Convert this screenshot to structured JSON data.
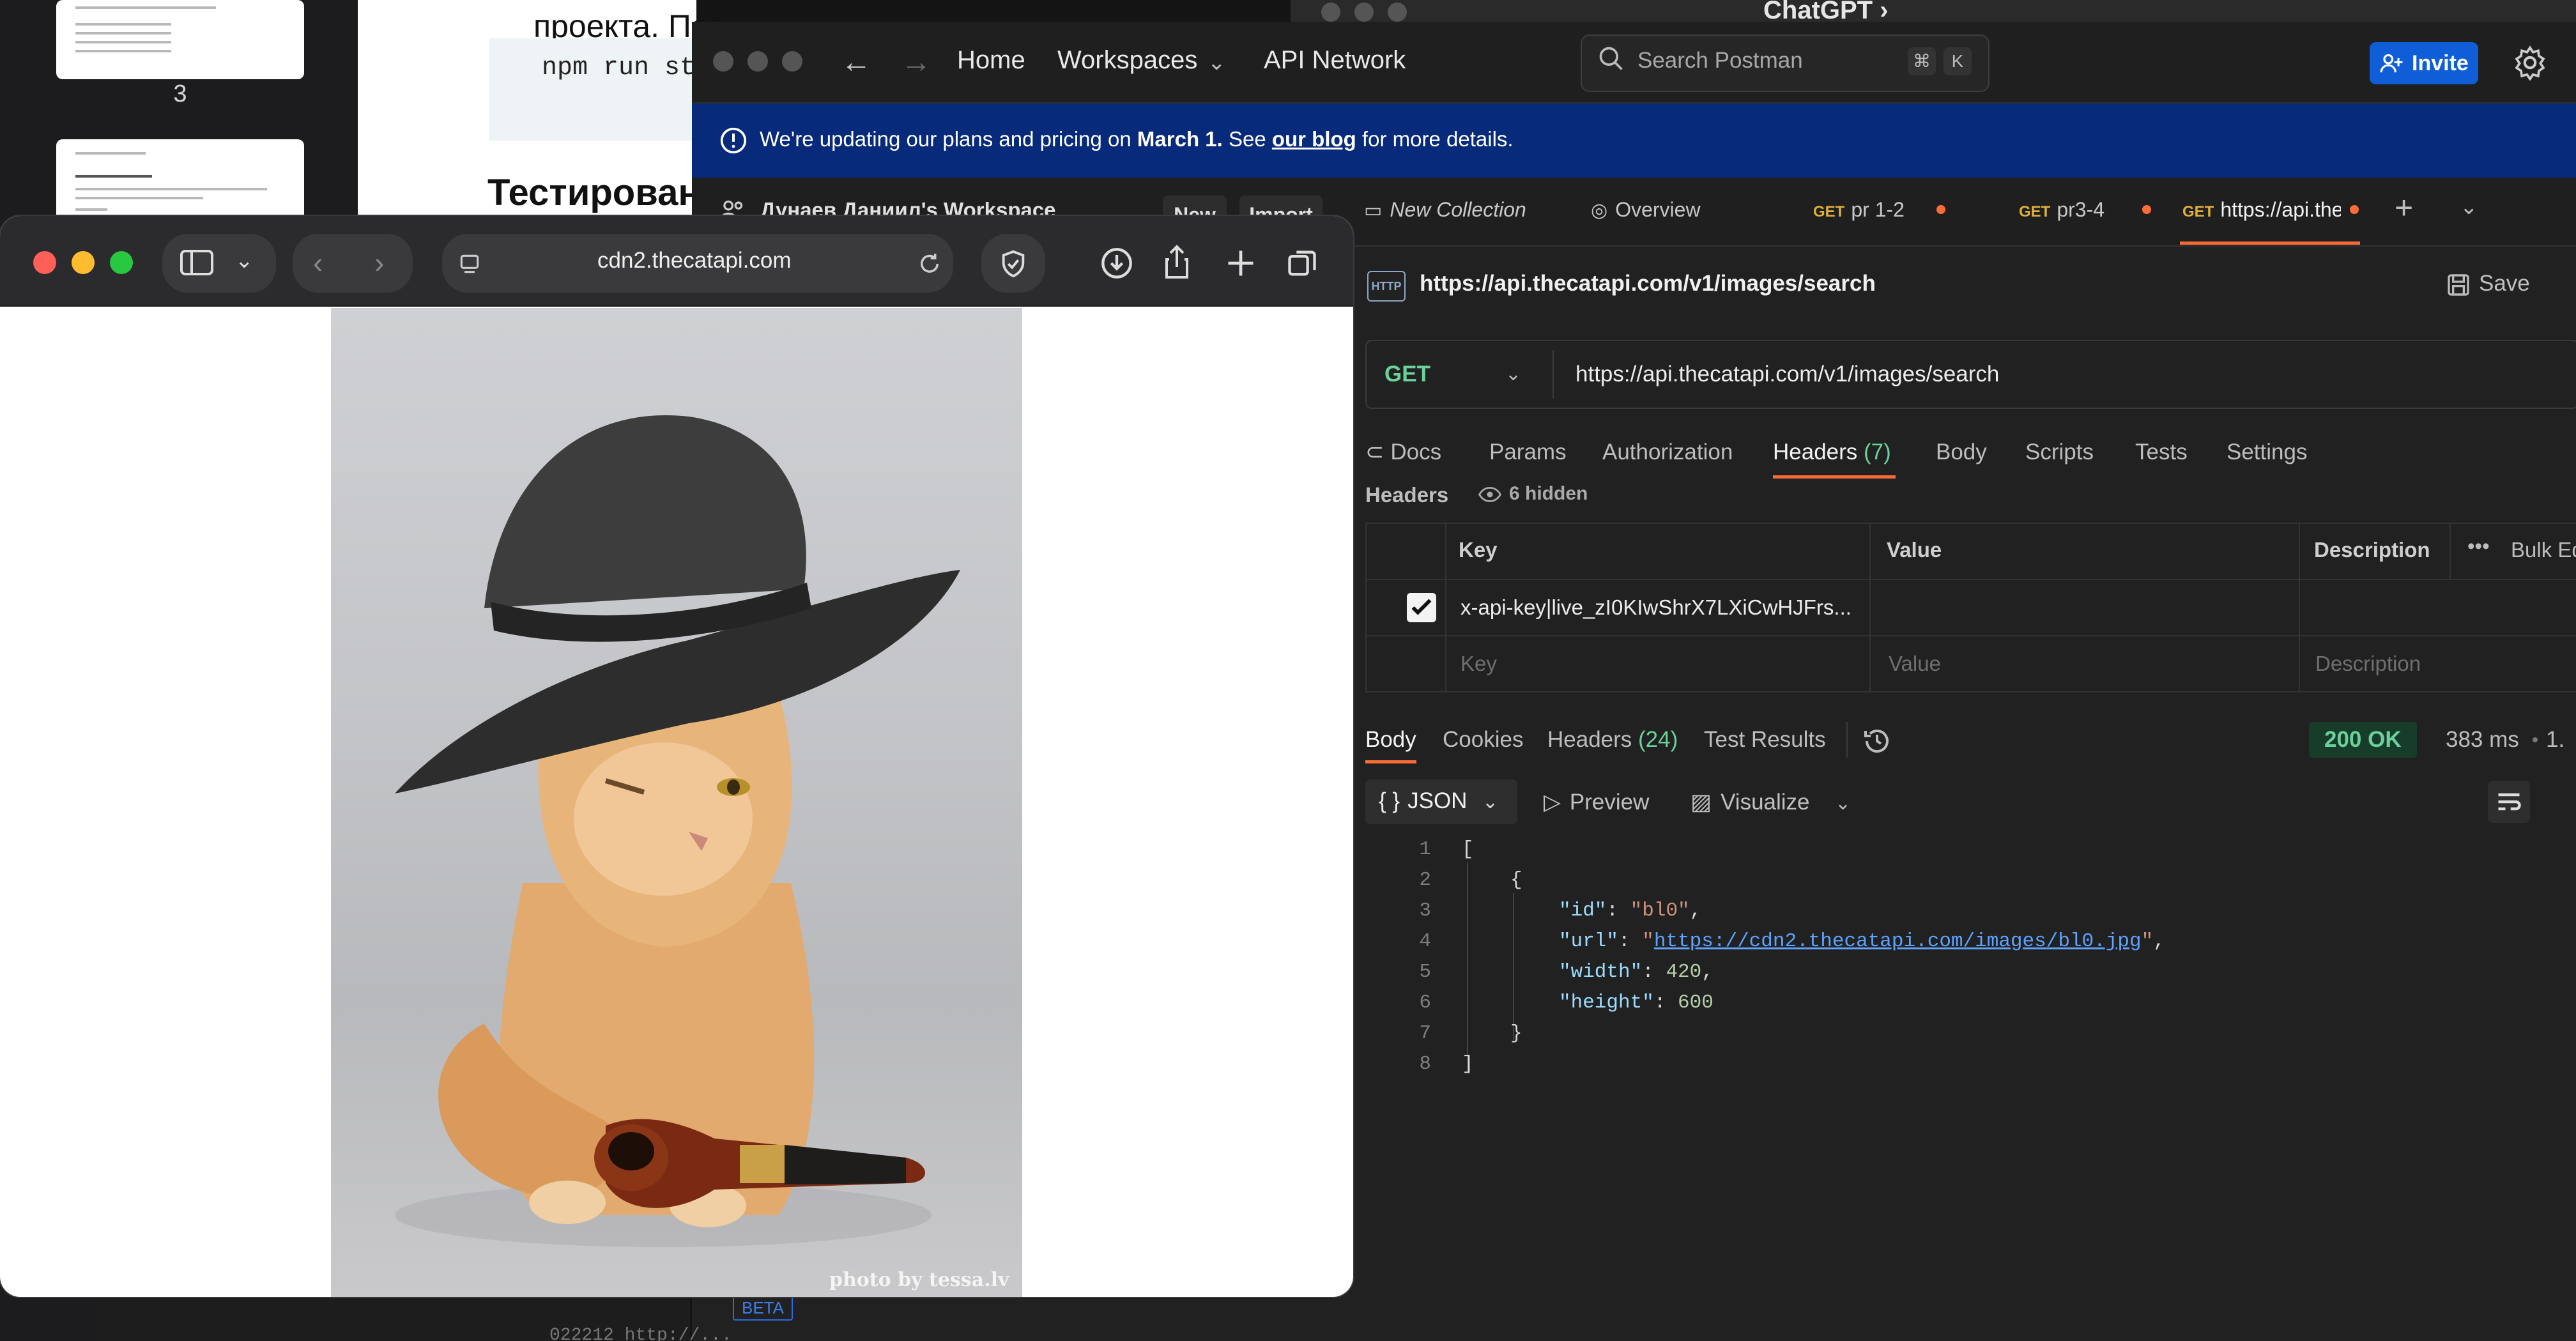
{
  "doc": {
    "thumb_page_number": "3",
    "line1": "проекта. После",
    "code_line": "npm run start",
    "heading": "Тестирование",
    "footer_text": "022212 http://..."
  },
  "chatgpt": {
    "title": "ChatGPT ›"
  },
  "postman": {
    "nav": {
      "home": "Home",
      "workspaces": "Workspaces",
      "api_network": "API Network"
    },
    "search": {
      "placeholder": "Search Postman",
      "kbd1": "⌘",
      "kbd2": "K"
    },
    "invite_label": "Invite",
    "banner": {
      "prefix": "We're updating our plans and pricing on ",
      "date": "March 1.",
      "middle": " See ",
      "link": "our blog",
      "suffix": " for more details."
    },
    "workspace": {
      "name": "Дунаев Даниил's Workspace",
      "new_label": "New",
      "import_label": "Import"
    },
    "tabs": [
      {
        "label": "New Collection"
      },
      {
        "label": "Overview"
      },
      {
        "method": "GET",
        "label": "pr 1-2"
      },
      {
        "method": "GET",
        "label": "pr3-4"
      },
      {
        "method": "GET",
        "label": "https://api.the"
      }
    ],
    "request": {
      "icon_text": "HTTP",
      "title": "https://api.thecatapi.com/v1/images/search",
      "save_label": "Save",
      "method": "GET",
      "url": "https://api.thecatapi.com/v1/images/search"
    },
    "request_tabs": {
      "docs": "Docs",
      "params": "Params",
      "authorization": "Authorization",
      "headers": "Headers",
      "headers_count": "(7)",
      "body": "Body",
      "scripts": "Scripts",
      "tests": "Tests",
      "settings": "Settings"
    },
    "headers_section": {
      "label": "Headers",
      "hidden": "6 hidden",
      "col_key": "Key",
      "col_value": "Value",
      "col_description": "Description",
      "bulk_edit": "Bulk Edit",
      "row_key": "x-api-key|live_zI0KIwShrX7LXiCwHJFrs...",
      "ph_key": "Key",
      "ph_value": "Value",
      "ph_description": "Description"
    },
    "response": {
      "tabs": {
        "body": "Body",
        "cookies": "Cookies",
        "headers": "Headers",
        "headers_count": "(24)",
        "test_results": "Test Results"
      },
      "status": "200 OK",
      "time": "383 ms",
      "size": "1.",
      "format": "JSON",
      "preview": "Preview",
      "visualize": "Visualize",
      "line_numbers": [
        "1",
        "2",
        "3",
        "4",
        "5",
        "6",
        "7",
        "8"
      ],
      "json": {
        "id_key": "\"id\"",
        "id_val": "\"bl0\"",
        "url_key": "\"url\"",
        "url_val": "https://cdn2.thecatapi.com/images/bl0.jpg",
        "width_key": "\"width\"",
        "width_val": "420",
        "height_key": "\"height\"",
        "height_val": "600"
      }
    }
  },
  "safari": {
    "url": "cdn2.thecatapi.com",
    "image_credit": "photo by tessa.lv"
  },
  "colors": {
    "postman_orange": "#ff6c37",
    "postman_blue": "#0f5ed7",
    "status_green": "#6bd19a",
    "banner_blue": "#072a7a"
  }
}
